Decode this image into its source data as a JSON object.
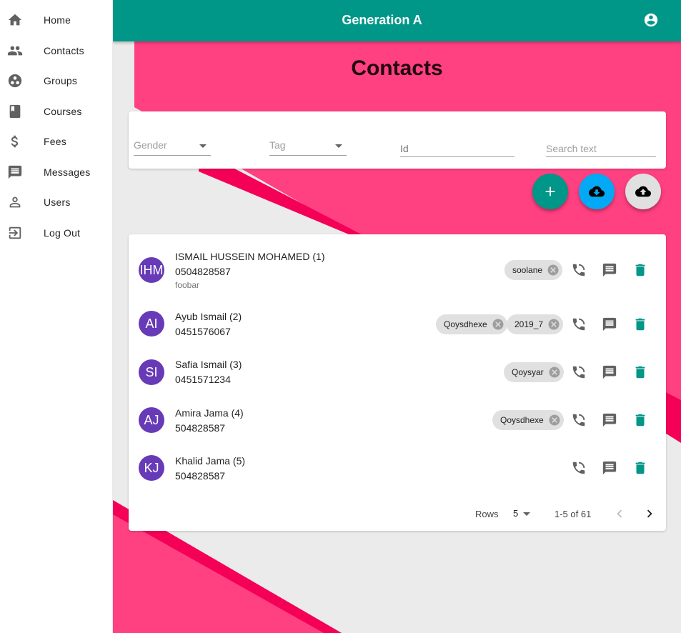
{
  "sidebar": {
    "items": [
      {
        "label": "Home",
        "icon": "home-icon"
      },
      {
        "label": "Contacts",
        "icon": "people-icon"
      },
      {
        "label": "Groups",
        "icon": "groups-icon"
      },
      {
        "label": "Courses",
        "icon": "book-icon"
      },
      {
        "label": "Fees",
        "icon": "dollar-icon"
      },
      {
        "label": "Messages",
        "icon": "message-icon"
      },
      {
        "label": "Users",
        "icon": "person-icon"
      },
      {
        "label": "Log Out",
        "icon": "logout-icon"
      }
    ]
  },
  "appbar": {
    "title": "Generation A",
    "account_icon": "account-circle-icon"
  },
  "page": {
    "title": "Contacts"
  },
  "filters": {
    "gender_placeholder": "Gender",
    "tag_placeholder": "Tag",
    "id_placeholder": "Id",
    "search_placeholder": "Search text"
  },
  "fabs": {
    "add_icon": "plus-icon",
    "download_icon": "cloud-download-icon",
    "upload_icon": "cloud-upload-icon"
  },
  "contacts": [
    {
      "initials": "IHM",
      "name": "ISMAIL HUSSEIN MOHAMED (1)",
      "phone": "0504828587",
      "note": "foobar",
      "tags": [
        "soolane"
      ]
    },
    {
      "initials": "AI",
      "name": "Ayub Ismail (2)",
      "phone": "0451576067",
      "note": "",
      "tags": [
        "Qoysdhexe",
        "2019_7"
      ]
    },
    {
      "initials": "SI",
      "name": "Safia Ismail (3)",
      "phone": "0451571234",
      "note": "",
      "tags": [
        "Qoysyar"
      ]
    },
    {
      "initials": "AJ",
      "name": "Amira Jama (4)",
      "phone": "504828587",
      "note": "",
      "tags": [
        "Qoysdhexe"
      ]
    },
    {
      "initials": "KJ",
      "name": "Khalid Jama (5)",
      "phone": "504828587",
      "note": "",
      "tags": []
    }
  ],
  "pagination": {
    "rows_label": "Rows",
    "rows_value": "5",
    "range_text": "1-5 of 61"
  },
  "colors": {
    "primary": "#009688",
    "accent_pink": "#ff4081",
    "avatar": "#673ab7",
    "download_fab": "#03a9f4",
    "delete_icon": "#009688"
  }
}
